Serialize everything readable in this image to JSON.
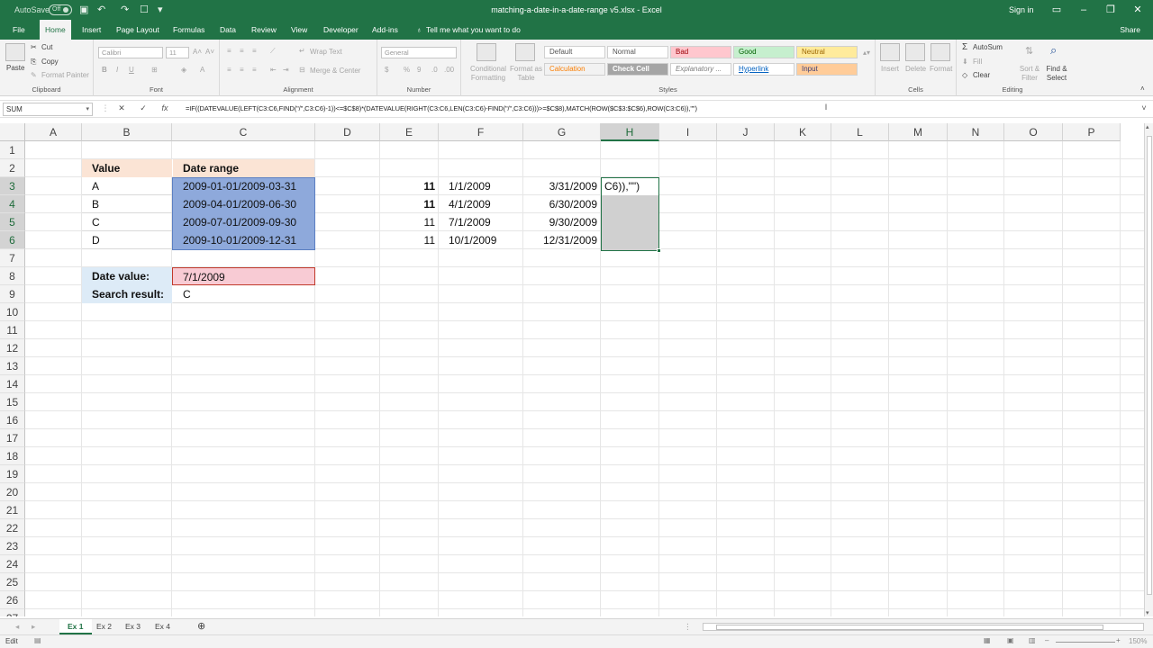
{
  "titlebar": {
    "autosave": "AutoSave",
    "autosave_state": "Off",
    "title": "matching-a-date-in-a-date-range v5.xlsx - Excel",
    "signin": "Sign in"
  },
  "menu": {
    "tabs": [
      "File",
      "Home",
      "Insert",
      "Page Layout",
      "Formulas",
      "Data",
      "Review",
      "View",
      "Developer",
      "Add-ins"
    ],
    "tell_me": "Tell me what you want to do",
    "share": "Share",
    "active_tab": "Home"
  },
  "ribbon": {
    "clipboard": {
      "paste": "Paste",
      "cut": "Cut",
      "copy": "Copy",
      "format_painter": "Format Painter",
      "label": "Clipboard"
    },
    "font": {
      "name": "Calibri",
      "size": "11",
      "label": "Font"
    },
    "alignment": {
      "wrap_text": "Wrap Text",
      "merge_center": "Merge & Center",
      "label": "Alignment"
    },
    "number": {
      "format": "General",
      "label": "Number"
    },
    "styles": {
      "conditional": "Conditional Formatting",
      "format_as_table": "Format as Table",
      "cells": [
        "Default",
        "Normal",
        "Bad",
        "Good",
        "Neutral",
        "Calculation",
        "Check Cell",
        "Explanatory ...",
        "Hyperlink",
        "Input"
      ],
      "label": "Styles"
    },
    "cells": {
      "insert": "Insert",
      "delete": "Delete",
      "format": "Format",
      "label": "Cells"
    },
    "editing": {
      "autosum": "AutoSum",
      "fill": "Fill",
      "clear": "Clear",
      "sort_filter": "Sort & Filter",
      "find_select": "Find & Select",
      "label": "Editing"
    }
  },
  "formula_bar": {
    "name_box": "SUM",
    "formula": "=IF((DATEVALUE(LEFT(C3:C6,FIND(\"/\",C3:C6)-1))<=$C$8)*(DATEVALUE(RIGHT(C3:C6,LEN(C3:C6)-FIND(\"/\",C3:C6)))>=$C$8),MATCH(ROW($C$3:$C$6),ROW(C3:C6)),\"\")"
  },
  "grid": {
    "columns": [
      "A",
      "B",
      "C",
      "D",
      "E",
      "F",
      "G",
      "H",
      "I",
      "J",
      "K",
      "L",
      "M",
      "N",
      "O",
      "P"
    ],
    "selected_column": "H",
    "rows": [
      "1",
      "2",
      "3",
      "4",
      "5",
      "6",
      "7",
      "8",
      "9",
      "10",
      "11",
      "12",
      "13",
      "14",
      "15",
      "16",
      "17",
      "18",
      "19",
      "20",
      "21",
      "22",
      "23",
      "24",
      "25",
      "26",
      "27"
    ],
    "table": {
      "header_value": "Value",
      "header_range": "Date range",
      "values": [
        "A",
        "B",
        "C",
        "D"
      ],
      "ranges": [
        "2009-01-01/2009-03-31",
        "2009-04-01/2009-06-30",
        "2009-07-01/2009-09-30",
        "2009-10-01/2009-12-31"
      ]
    },
    "date_value_label": "Date value:",
    "date_value": "7/1/2009",
    "search_result_label": "Search result:",
    "search_result": "C",
    "helper": {
      "e": [
        "11",
        "11",
        "11",
        "11"
      ],
      "f": [
        "1/1/2009",
        "4/1/2009",
        "7/1/2009",
        "10/1/2009"
      ],
      "g": [
        "3/31/2009",
        "6/30/2009",
        "9/30/2009",
        "12/31/2009"
      ],
      "h3": "C6)),\"\")"
    }
  },
  "sheets": {
    "tabs": [
      "Ex 1",
      "Ex 2",
      "Ex 3",
      "Ex 4"
    ],
    "active": "Ex 1"
  },
  "status": {
    "mode": "Edit",
    "zoom": "150%"
  }
}
